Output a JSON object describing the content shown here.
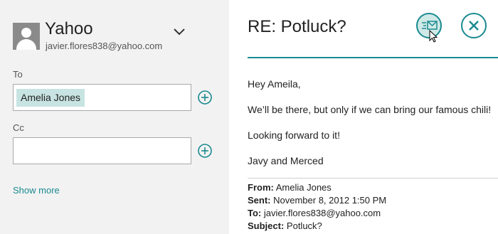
{
  "account": {
    "name": "Yahoo",
    "email": "javier.flores838@yahoo.com"
  },
  "compose": {
    "to_label": "To",
    "to_recipients": [
      "Amelia Jones"
    ],
    "cc_label": "Cc",
    "cc_value": "",
    "show_more": "Show more"
  },
  "message": {
    "subject": "RE: Potluck?",
    "body": [
      "Hey Ameila,",
      "We’ll be there, but only if we can bring our famous chili!",
      "Looking forward to it!",
      "Javy and Merced"
    ],
    "quoted": {
      "from_label": "From:",
      "from_value": "Amelia Jones",
      "sent_label": "Sent:",
      "sent_value": "November 8, 2012 1:50 PM",
      "to_label": "To:",
      "to_value": "javier.flores838@yahoo.com",
      "subject_label": "Subject:",
      "subject_value": "Potluck?"
    }
  },
  "icons": {
    "send": "send-icon",
    "close": "close-icon",
    "add": "plus-icon",
    "account": "avatar",
    "expand": "chevron-down-icon"
  },
  "colors": {
    "accent": "#1a8a8f",
    "chip": "#c8e4e2",
    "left_pane": "#f2f2f2"
  }
}
